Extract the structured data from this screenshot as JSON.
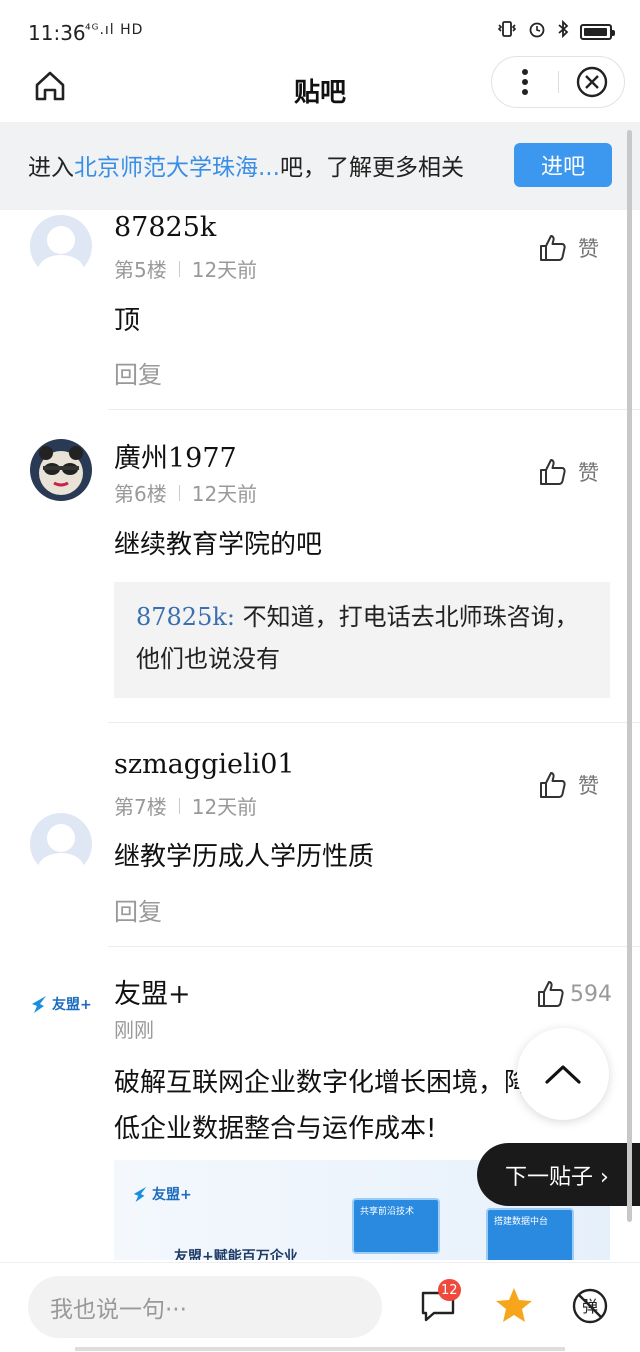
{
  "status_bar": {
    "time": "11:36",
    "network": "⁴ᴳ.ıl HD"
  },
  "nav": {
    "title": "贴吧"
  },
  "banner": {
    "prefix": "进入",
    "forum": "北京师范大学珠海...",
    "suffix": "吧，了解更多相关",
    "join": "进吧"
  },
  "posts": [
    {
      "username": "87825k",
      "floor": "第5楼",
      "time": "12天前",
      "content": "顶",
      "reply": "回复",
      "like": "赞"
    },
    {
      "username": "廣州1977",
      "floor": "第6楼",
      "time": "12天前",
      "content": "继续教育学院的吧",
      "like": "赞",
      "quote": {
        "name": "87825k:",
        "text": " 不知道，打电话去北师珠咨询，他们也说没有"
      }
    },
    {
      "username": "szmaggieli01",
      "floor": "第7楼",
      "time": "12天前",
      "content": "继教学历成人学历性质",
      "reply": "回复",
      "like": "赞"
    }
  ],
  "ad": {
    "brand": "友盟+",
    "time": "刚刚",
    "likes": "594",
    "content": "破解互联网企业数字化增长困境，降低企业数据整合与运作成本!",
    "image_brand": "友盟+",
    "image_card_1": "共享前沿技术",
    "image_card_2": "搭建数据中台",
    "image_caption": "友盟+赋能百万企业"
  },
  "floating": {
    "next_post": "下一贴子 ›"
  },
  "bottom_bar": {
    "input_placeholder": "我也说一句···",
    "comment_badge": "12"
  }
}
